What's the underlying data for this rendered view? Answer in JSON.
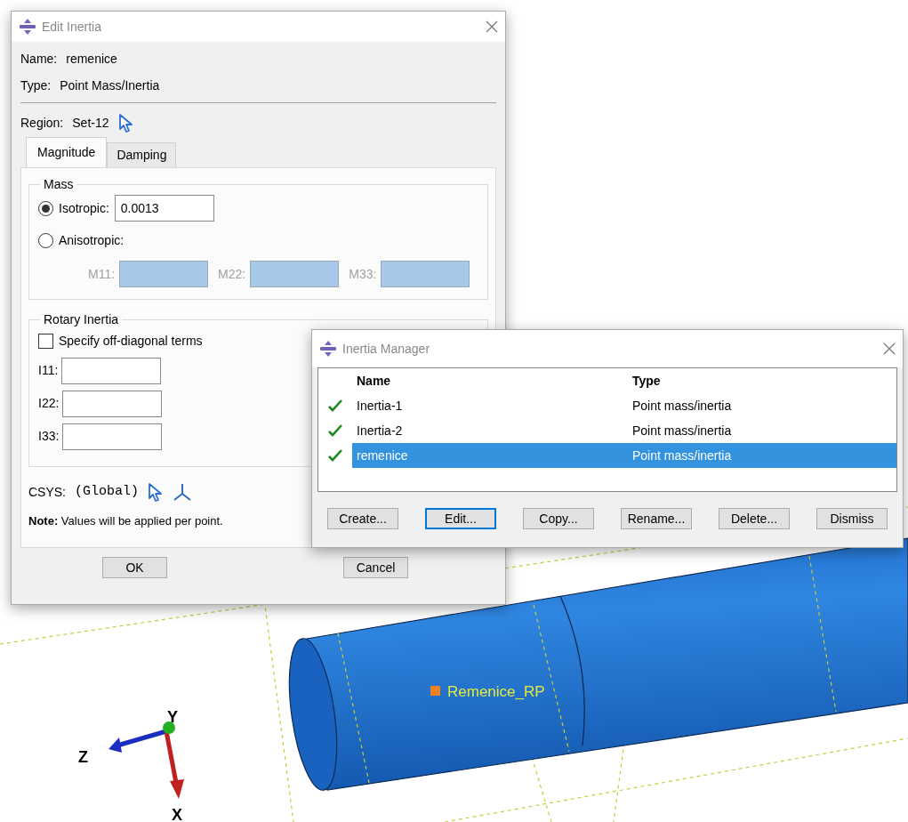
{
  "edit_dialog": {
    "title": "Edit Inertia",
    "name_label": "Name:",
    "name": "remenice",
    "type_label": "Type:",
    "type": "Point Mass/Inertia",
    "region_label": "Region:",
    "region": "Set-12",
    "tabs": [
      {
        "label": "Magnitude",
        "selected": true
      },
      {
        "label": "Damping",
        "selected": false
      }
    ],
    "mass": {
      "legend": "Mass",
      "options": [
        {
          "label": "Isotropic:",
          "selected": true,
          "value": "0.0013"
        },
        {
          "label": "Anisotropic:",
          "selected": false
        }
      ],
      "components": [
        {
          "label": "M11:",
          "disabled": true
        },
        {
          "label": "M22:",
          "disabled": true
        },
        {
          "label": "M33:",
          "disabled": true
        }
      ]
    },
    "rotary": {
      "legend": "Rotary Inertia",
      "off_diagonal": {
        "label": "Specify off-diagonal terms",
        "checked": false
      },
      "components": [
        {
          "label": "I11:",
          "disabled": false
        },
        {
          "label": "I22:",
          "disabled": false
        },
        {
          "label": "I33:",
          "disabled": false
        }
      ]
    },
    "csys_label": "CSYS:",
    "csys": "(Global)",
    "note": "**Note:**  Values will be applied per point.",
    "buttons": [
      "OK",
      "Cancel"
    ]
  },
  "manager": {
    "title": "Inertia Manager",
    "columns": [
      "Name",
      "Type"
    ],
    "rows": [
      {
        "name": "Inertia-1",
        "type": "Point mass/inertia",
        "active": true,
        "selected": false
      },
      {
        "name": "Inertia-2",
        "type": "Point mass/inertia",
        "active": true,
        "selected": false
      },
      {
        "name": "remenice",
        "type": "Point mass/inertia",
        "active": true,
        "selected": true
      }
    ],
    "buttons": [
      {
        "label": "Create...",
        "focused": false
      },
      {
        "label": "Edit...",
        "focused": true
      },
      {
        "label": "Copy...",
        "focused": false
      },
      {
        "label": "Rename...",
        "focused": false
      },
      {
        "label": "Delete...",
        "focused": false
      },
      {
        "label": "Dismiss",
        "focused": false
      }
    ]
  },
  "viewport": {
    "reference_point": "Remenice_RP",
    "axes": {
      "y": "Y",
      "z": "Z",
      "x": "X"
    }
  }
}
